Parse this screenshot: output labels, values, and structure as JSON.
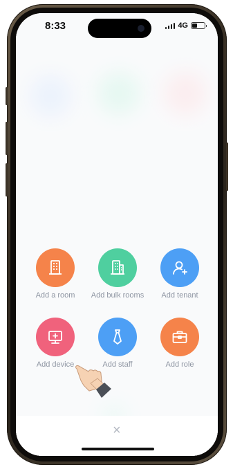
{
  "status_bar": {
    "time": "8:33",
    "network": "4G"
  },
  "actions": [
    {
      "label": "Add a room",
      "color": "#f5834a",
      "icon": "building-icon"
    },
    {
      "label": "Add bulk rooms",
      "color": "#4fcf9f",
      "icon": "buildings-icon"
    },
    {
      "label": "Add tenant",
      "color": "#4d9ff5",
      "icon": "user-plus-icon"
    },
    {
      "label": "Add device",
      "color": "#f0627c",
      "icon": "monitor-plus-icon"
    },
    {
      "label": "Add staff",
      "color": "#4d9ff5",
      "icon": "tie-icon"
    },
    {
      "label": "Add role",
      "color": "#f5834a",
      "icon": "briefcase-icon"
    }
  ],
  "close_symbol": "×"
}
